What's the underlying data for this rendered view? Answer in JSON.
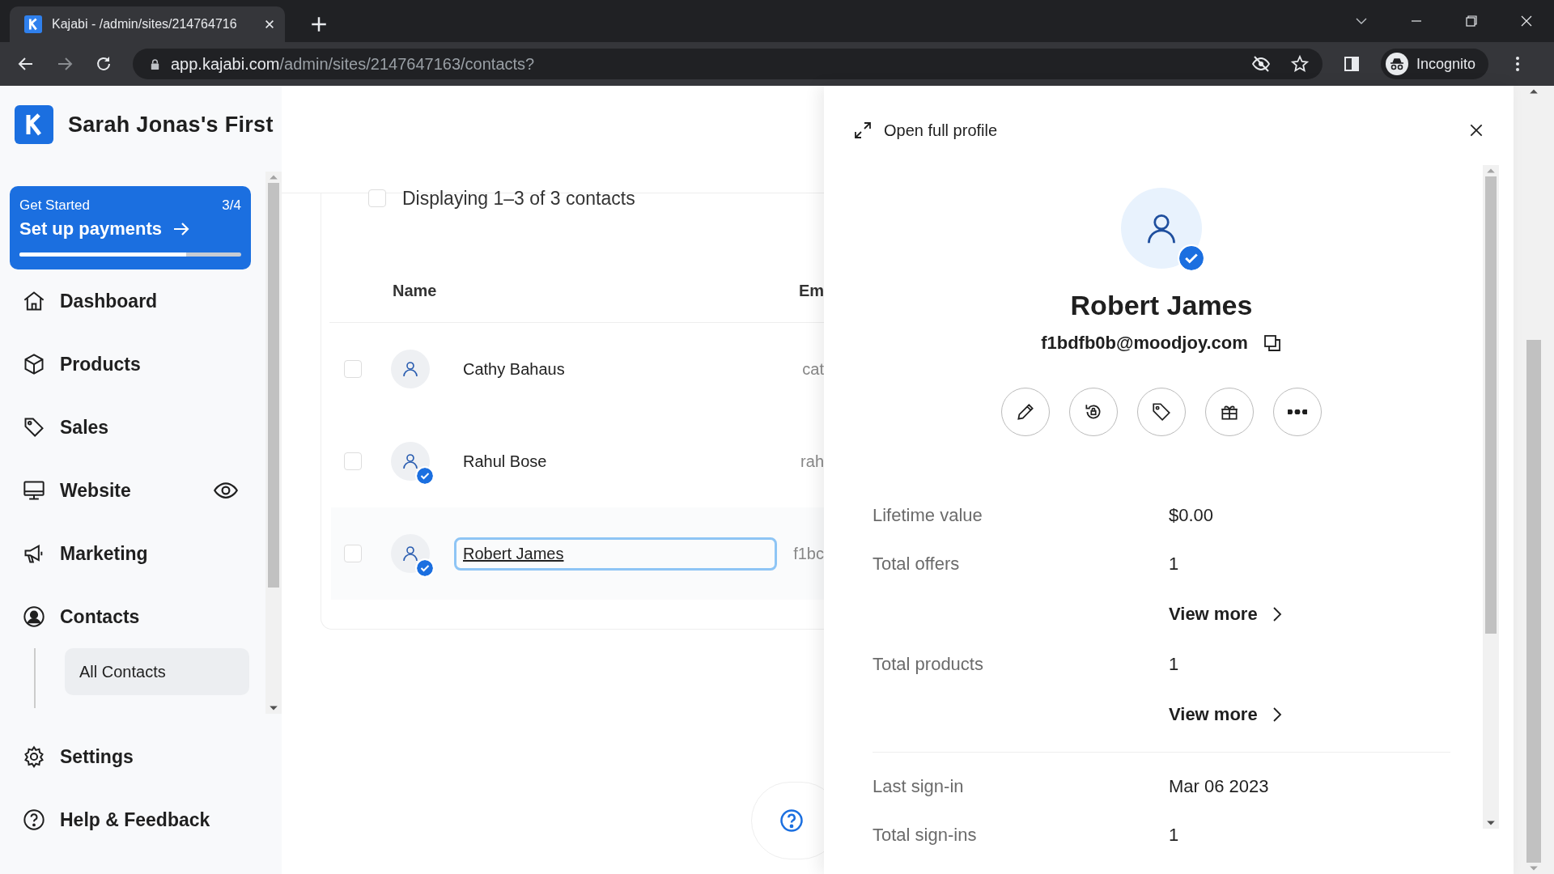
{
  "browser": {
    "tab_title": "Kajabi - /admin/sites/214764716",
    "url_host": "app.kajabi.com",
    "url_path": "/admin/sites/2147647163/contacts?",
    "profile_label": "Incognito"
  },
  "sidebar": {
    "site_name": "Sarah Jonas's First",
    "onboarding": {
      "label": "Get Started",
      "count": "3/4",
      "title": "Set up payments",
      "level": 0.75
    },
    "items": [
      {
        "kind": "dashboard",
        "label": "Dashboard",
        "preview": false
      },
      {
        "kind": "products",
        "label": "Products",
        "preview": false
      },
      {
        "kind": "sales",
        "label": "Sales",
        "preview": false
      },
      {
        "kind": "website",
        "label": "Website",
        "preview": true
      },
      {
        "kind": "marketing",
        "label": "Marketing",
        "preview": false
      },
      {
        "kind": "contacts",
        "label": "Contacts",
        "preview": false,
        "children": [
          {
            "label": "All Contacts",
            "selected": true
          }
        ]
      }
    ],
    "footer_items": [
      {
        "kind": "settings",
        "label": "Settings"
      },
      {
        "kind": "help",
        "label": "Help & Feedback"
      }
    ]
  },
  "contacts_table": {
    "select_all_checked": false,
    "count_text": "Displaying 1–3 of 3 contacts",
    "columns": [
      "Name",
      "Em"
    ],
    "rows": [
      {
        "name": "Cathy Bahaus",
        "column_2": "cat",
        "verified": false,
        "checked": false,
        "focused": false
      },
      {
        "name": "Rahul Bose",
        "column_2": "rah",
        "verified": true,
        "checked": false,
        "focused": false
      },
      {
        "name": "Robert James",
        "column_2": "f1bc",
        "verified": true,
        "checked": false,
        "focused": true
      }
    ]
  },
  "profile_panel": {
    "open_label": "Open full profile",
    "contact": {
      "name": "Robert James",
      "email": "f1bdfb0b@moodjoy.com",
      "verified": true
    },
    "actions": [
      {
        "kind": "edit"
      },
      {
        "kind": "reset"
      },
      {
        "kind": "tag"
      },
      {
        "kind": "gift"
      },
      {
        "kind": "more"
      }
    ],
    "sections": [
      {
        "rows": [
          {
            "kind": "stat",
            "label": "Lifetime value",
            "value": "$0.00"
          },
          {
            "kind": "stat",
            "label": "Total offers",
            "value": "1"
          },
          {
            "kind": "link",
            "label": "View more"
          },
          {
            "kind": "stat",
            "label": "Total products",
            "value": "1"
          },
          {
            "kind": "link",
            "label": "View more"
          }
        ]
      },
      {
        "rows": [
          {
            "kind": "stat",
            "label": "Last sign-in",
            "value": "Mar 06 2023"
          },
          {
            "kind": "stat",
            "label": "Total sign-ins",
            "value": "1"
          }
        ]
      }
    ]
  }
}
